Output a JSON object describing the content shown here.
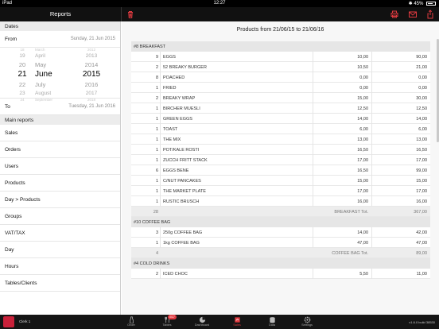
{
  "status": {
    "left": "iPad",
    "time": "12:27",
    "battery": "45%"
  },
  "topbar": {
    "title": "Reports"
  },
  "sidebar": {
    "dates_header": "Dates",
    "from_label": "From",
    "from_value": "Sunday, 21 Jun 2015",
    "to_label": "To",
    "to_value": "Tuesday, 21 Jun 2016",
    "picker": {
      "days": [
        "18",
        "19",
        "20",
        "21",
        "22",
        "23",
        "24"
      ],
      "months": [
        "March",
        "April",
        "May",
        "June",
        "July",
        "August",
        "September"
      ],
      "years": [
        "2012",
        "2013",
        "2014",
        "2015",
        "2016",
        "2017",
        "2018"
      ]
    },
    "main_reports_header": "Main reports",
    "items": [
      "Sales",
      "Orders",
      "Users",
      "Products",
      "Day > Products",
      "Groups",
      "VAT/TAX",
      "Day",
      "Hours",
      "Tables/Clients"
    ]
  },
  "main": {
    "title": "Products from 21/06/15 to 21/06/16",
    "groups": [
      {
        "name": "#8 BREAKFAST",
        "rows": [
          {
            "qty": "9",
            "name": "EGGS",
            "price": "10,00",
            "total": "90,00"
          },
          {
            "qty": "2",
            "name": "52 BREAKY BURGER",
            "price": "10,50",
            "total": "21,00"
          },
          {
            "qty": "8",
            "name": "POACHED",
            "price": "0,00",
            "total": "0,00"
          },
          {
            "qty": "1",
            "name": "FRIED",
            "price": "0,00",
            "total": "0,00"
          },
          {
            "qty": "2",
            "name": "BREAKY WRAP",
            "price": "15,00",
            "total": "30,00"
          },
          {
            "qty": "1",
            "name": "BIRCHER MUESLI",
            "price": "12,50",
            "total": "12,50"
          },
          {
            "qty": "1",
            "name": "GREEN EGGS",
            "price": "14,00",
            "total": "14,00"
          },
          {
            "qty": "1",
            "name": "TOAST",
            "price": "6,00",
            "total": "6,00"
          },
          {
            "qty": "1",
            "name": "THE MIX",
            "price": "13,00",
            "total": "13,00"
          },
          {
            "qty": "1",
            "name": "POT/KALE ROSTI",
            "price": "16,50",
            "total": "16,50"
          },
          {
            "qty": "1",
            "name": "ZUCCH FRITT STACK",
            "price": "17,00",
            "total": "17,00"
          },
          {
            "qty": "6",
            "name": "EGGS BENE",
            "price": "16,50",
            "total": "99,00"
          },
          {
            "qty": "1",
            "name": "C/NUT PANCAKES",
            "price": "15,00",
            "total": "15,00"
          },
          {
            "qty": "1",
            "name": "THE MARKET PLATE",
            "price": "17,00",
            "total": "17,00"
          },
          {
            "qty": "1",
            "name": "RUSTIC BRUSCH",
            "price": "16,00",
            "total": "16,00"
          }
        ],
        "total": {
          "qty": "28",
          "label": "BREAKFAST Tot.",
          "total": "367,00"
        }
      },
      {
        "name": "#10 COFFEE BAG",
        "rows": [
          {
            "qty": "3",
            "name": "250g COFFEE BAG",
            "price": "14,00",
            "total": "42,00"
          },
          {
            "qty": "1",
            "name": "1kg COFFEE BAG",
            "price": "47,00",
            "total": "47,00"
          }
        ],
        "total": {
          "qty": "4",
          "label": "COFFEE BAG Tot.",
          "total": "89,00"
        }
      },
      {
        "name": "#4 COLD DRINKS",
        "rows": [
          {
            "qty": "2",
            "name": "ICED CHOC",
            "price": "5,50",
            "total": "11,00"
          }
        ],
        "total": null
      }
    ]
  },
  "tabbar": {
    "clerk": "Clerk 1",
    "tabs": [
      {
        "label": "Order",
        "icon": "bottle-icon"
      },
      {
        "label": "Tables",
        "icon": "cutlery-icon",
        "badge": "0/17"
      },
      {
        "label": "Dashboard",
        "icon": "pie-chart-icon"
      },
      {
        "label": "Sales",
        "icon": "sales-icon",
        "active": true
      },
      {
        "label": "Data",
        "icon": "database-icon"
      },
      {
        "label": "Settings",
        "icon": "gear-icon"
      }
    ],
    "version": "v1.6.0 build 38530"
  },
  "colors": {
    "accent": "#e03a40",
    "topbar": "#111111",
    "tabbar": "#151515"
  }
}
